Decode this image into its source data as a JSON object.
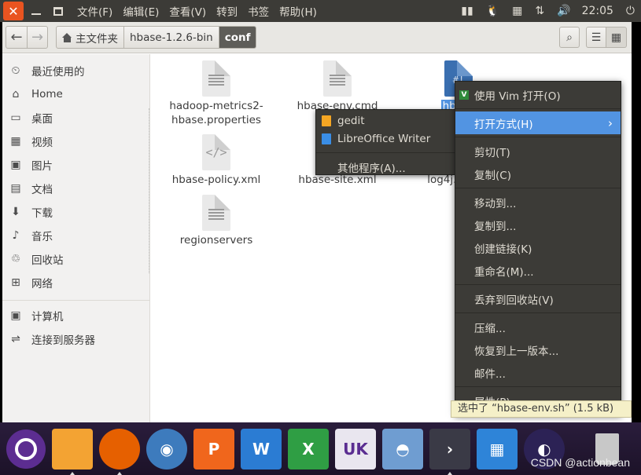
{
  "topbar": {
    "close_glyph": "✕",
    "menus": [
      "文件(F)",
      "编辑(E)",
      "查看(V)",
      "转到",
      "书签",
      "帮助(H)"
    ],
    "clock": "22:05",
    "indicator_icons": [
      "keyboard-icon",
      "tux-icon",
      "calendar-icon",
      "network-icon",
      "volume-icon",
      "power-icon"
    ]
  },
  "toolbar": {
    "back_glyph": "←",
    "forward_glyph": "→",
    "breadcrumbs": [
      "主文件夹",
      "hbase-1.2.6-bin",
      "conf"
    ],
    "search_glyph": "⌕",
    "list_glyph": "☰",
    "grid_glyph": "▦"
  },
  "sidebar": {
    "items": [
      {
        "label": "最近使用的",
        "icon": "⏲"
      },
      {
        "label": "Home",
        "icon": "⌂"
      },
      {
        "label": "桌面",
        "icon": "▭"
      },
      {
        "label": "视频",
        "icon": "▦"
      },
      {
        "label": "图片",
        "icon": "▣"
      },
      {
        "label": "文档",
        "icon": "▤"
      },
      {
        "label": "下载",
        "icon": "⬇"
      },
      {
        "label": "音乐",
        "icon": "♪"
      },
      {
        "label": "回收站",
        "icon": "♲"
      },
      {
        "label": "网络",
        "icon": "⊞"
      }
    ],
    "devices": [
      {
        "label": "计算机",
        "icon": "▣"
      },
      {
        "label": "连接到服务器",
        "icon": "⇌"
      }
    ]
  },
  "files": [
    {
      "name": "hadoop-metrics2-hbase.properties",
      "line1": "hadoop-metrics2-",
      "line2": "hbase.properties",
      "kind": "text"
    },
    {
      "name": "hbase-env.cmd",
      "line1": "hbase-env.cmd",
      "line2": "",
      "kind": "text"
    },
    {
      "name": "hbase-env.sh",
      "line1": "hbase",
      "line2": "",
      "kind": "script",
      "glyph": "#!"
    },
    {
      "name": "hbase-policy.xml",
      "line1": "hbase-policy.xml",
      "line2": "",
      "kind": "code",
      "glyph": "</>"
    },
    {
      "name": "hbase-site.xml",
      "line1": "hbase-site.xml",
      "line2": "",
      "kind": "text"
    },
    {
      "name": "log4j.properties",
      "line1": "log4j.p",
      "line2": "",
      "kind": "text"
    },
    {
      "name": "regionservers",
      "line1": "regionservers",
      "line2": "",
      "kind": "text"
    }
  ],
  "submenu": {
    "apps": [
      "gedit",
      "LibreOffice Writer"
    ],
    "other": "其他程序(A)..."
  },
  "context_menu": {
    "open_vim": "使用 Vim 打开(O)",
    "open_with": "打开方式(H)",
    "open_with_arrow": "›",
    "cut": "剪切(T)",
    "copy": "复制(C)",
    "move_to": "移动到...",
    "copy_to": "复制到...",
    "make_link": "创建链接(K)",
    "rename": "重命名(M)...",
    "trash": "丢弃到回收站(V)",
    "compress": "压缩...",
    "restore": "恢复到上一版本...",
    "email": "邮件...",
    "properties": "属性(P)"
  },
  "statusbar": {
    "text": "选中了 “hbase-env.sh” (1.5 kB)"
  },
  "dock": {
    "items": [
      {
        "name": "ubuntu-dash"
      },
      {
        "name": "files",
        "running": true
      },
      {
        "name": "firefox",
        "running": true
      },
      {
        "name": "chromium"
      },
      {
        "name": "wps-presentation",
        "label": "P"
      },
      {
        "name": "wps-writer",
        "label": "W"
      },
      {
        "name": "wps-spreadsheet",
        "label": "X"
      },
      {
        "name": "ubuntu-kylin-store",
        "label": "UK"
      },
      {
        "name": "software-center"
      },
      {
        "name": "terminal",
        "label": "›",
        "running": true
      },
      {
        "name": "app-grid"
      },
      {
        "name": "eclipse"
      },
      {
        "name": "trash"
      }
    ]
  },
  "watermark": "CSDN @actionbean"
}
